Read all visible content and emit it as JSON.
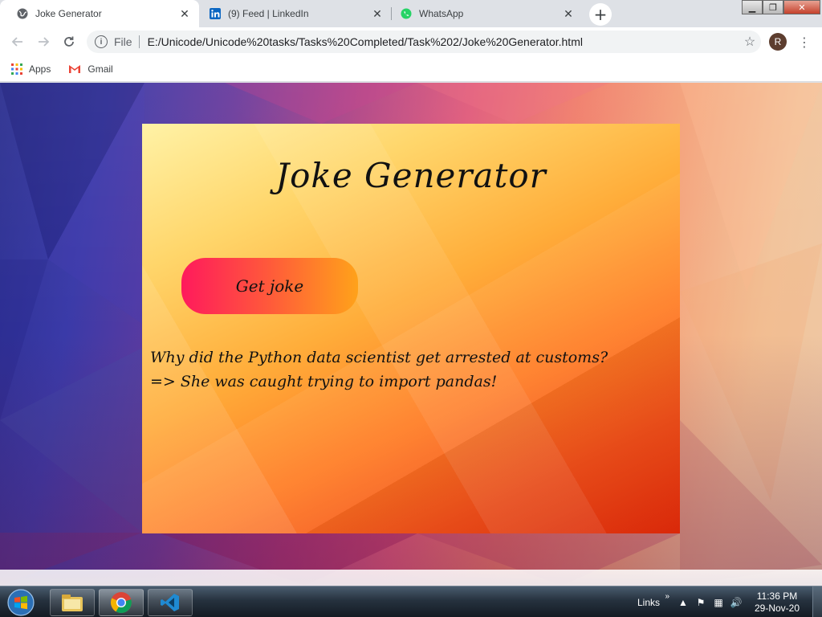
{
  "browser": {
    "tabs": [
      {
        "title": "Joke Generator",
        "icon": "globe-icon"
      },
      {
        "title": "(9) Feed | LinkedIn",
        "icon": "linkedin-icon"
      },
      {
        "title": "WhatsApp",
        "icon": "whatsapp-icon"
      }
    ],
    "tab_close": "✕",
    "new_tab": "+",
    "omnibox": {
      "scheme": "File",
      "url": "E:/Unicode/Unicode%20tasks/Tasks%20Completed/Task%202/Joke%20Generator.html"
    },
    "profile_initial": "R",
    "bookmarks": [
      {
        "label": "Apps",
        "icon": "apps-grid-icon"
      },
      {
        "label": "Gmail",
        "icon": "gmail-icon"
      }
    ]
  },
  "page": {
    "title": "Joke Generator",
    "button_label": "Get joke",
    "joke_line1": "Why did the Python data scientist get arrested at customs?",
    "joke_line2": "=> She was caught trying to import pandas!"
  },
  "taskbar": {
    "links_label": "Links",
    "links_chevron": "»",
    "time": "11:36 PM",
    "date": "29-Nov-20"
  },
  "colors": {
    "button_start": "#ff1a5c",
    "button_end": "#ffa21a",
    "card_top": "#fff2a6",
    "card_bottom": "#e52a0a"
  }
}
